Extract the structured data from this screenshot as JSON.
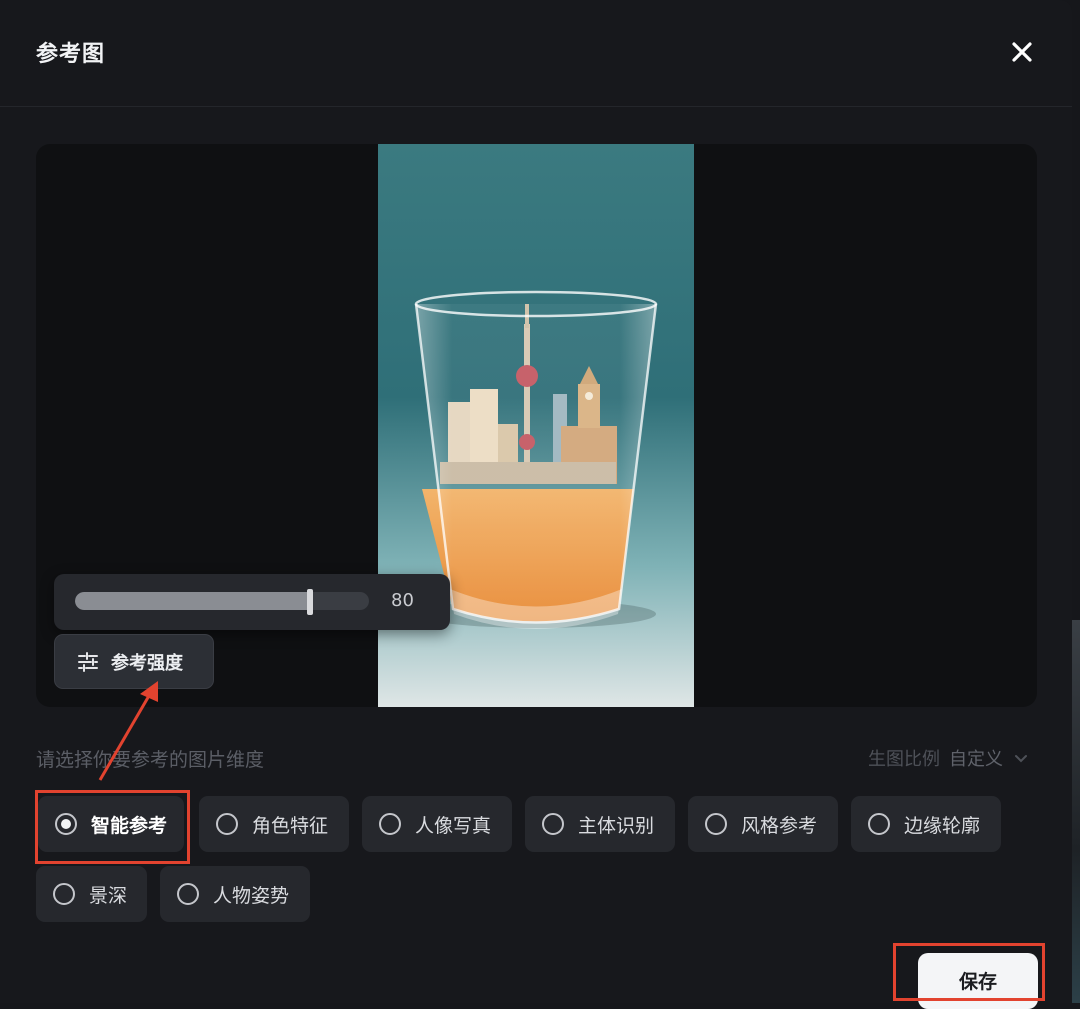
{
  "dialog": {
    "title": "参考图",
    "close_icon": "close-icon"
  },
  "preview": {
    "image_subject": "glass-with-city-skyline-and-juice"
  },
  "strength": {
    "value": "80",
    "level": 0.8,
    "button_label": "参考强度",
    "button_icon": "sliders-icon"
  },
  "dimension": {
    "label": "请选择你要参考的图片维度",
    "ratio_label": "生图比例",
    "ratio_value": "自定义",
    "options": [
      {
        "label": "智能参考",
        "selected": true
      },
      {
        "label": "角色特征",
        "selected": false
      },
      {
        "label": "人像写真",
        "selected": false
      },
      {
        "label": "主体识别",
        "selected": false
      },
      {
        "label": "风格参考",
        "selected": false
      },
      {
        "label": "边缘轮廓",
        "selected": false
      },
      {
        "label": "景深",
        "selected": false
      },
      {
        "label": "人物姿势",
        "selected": false
      }
    ]
  },
  "footer": {
    "save_label": "保存"
  },
  "colors": {
    "background": "#17181c",
    "annotation": "#e2432f",
    "chip": "#26282d"
  }
}
